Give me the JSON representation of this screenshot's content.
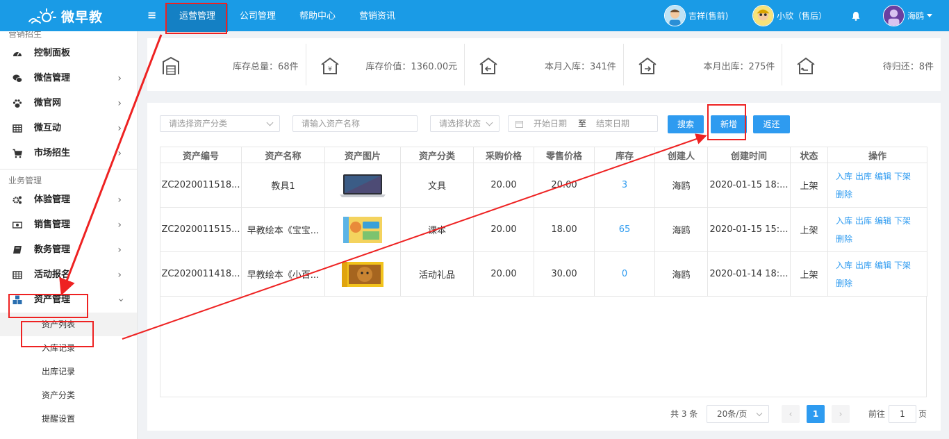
{
  "app": {
    "logo_text": "微早教"
  },
  "topnav": [
    {
      "label": "运营管理",
      "active": true
    },
    {
      "label": "公司管理"
    },
    {
      "label": "帮助中心"
    },
    {
      "label": "营销资讯"
    }
  ],
  "users": [
    {
      "name": "吉祥(售前)"
    },
    {
      "name": "小欣（售后）"
    },
    {
      "name": "海鸥"
    }
  ],
  "sidebar": {
    "section1": "营销招生",
    "group1": [
      {
        "label": "控制面板",
        "icon": "dashboard-icon",
        "chevron": false
      },
      {
        "label": "微信管理",
        "icon": "wechat-icon",
        "chevron": true
      },
      {
        "label": "微官网",
        "icon": "paw-icon",
        "chevron": true
      },
      {
        "label": "微互动",
        "icon": "grid-icon",
        "chevron": true
      },
      {
        "label": "市场招生",
        "icon": "cart-icon",
        "chevron": true
      }
    ],
    "section2": "业务管理",
    "group2": [
      {
        "label": "体验管理",
        "icon": "gears-icon",
        "chevron": true
      },
      {
        "label": "销售管理",
        "icon": "money-icon",
        "chevron": true
      },
      {
        "label": "教务管理",
        "icon": "book-icon",
        "chevron": true
      },
      {
        "label": "活动报名",
        "icon": "table-icon",
        "chevron": true
      },
      {
        "label": "资产管理",
        "icon": "cubes-icon",
        "chevron": "down"
      }
    ],
    "sub": [
      {
        "label": "资产列表",
        "active": true
      },
      {
        "label": "入库记录"
      },
      {
        "label": "出库记录"
      },
      {
        "label": "资产分类"
      },
      {
        "label": "提醒设置"
      }
    ]
  },
  "stats": [
    {
      "label": "库存总量：68件",
      "icon": "warehouse-icon"
    },
    {
      "label": "库存价值：1360.00元",
      "icon": "yen-house-icon"
    },
    {
      "label": "本月入库：341件",
      "icon": "inbound-icon"
    },
    {
      "label": "本月出库：275件",
      "icon": "outbound-icon"
    },
    {
      "label": "待归还：8件",
      "icon": "return-icon"
    }
  ],
  "filters": {
    "category_placeholder": "请选择资产分类",
    "name_placeholder": "请输入资产名称",
    "status_placeholder": "请选择状态",
    "start_placeholder": "开始日期",
    "to": "至",
    "end_placeholder": "结束日期",
    "search": "搜索",
    "add": "新增",
    "back": "返还"
  },
  "table": {
    "headers": [
      "资产编号",
      "资产名称",
      "资产图片",
      "资产分类",
      "采购价格",
      "零售价格",
      "库存",
      "创建人",
      "创建时间",
      "状态",
      "操作"
    ],
    "rows": [
      {
        "code": "ZC2020011518...",
        "name": "教具1",
        "category": "文具",
        "buy": "20.00",
        "sell": "20.00",
        "stock": "3",
        "creator": "海鸥",
        "created": "2020-01-15 18:...",
        "status": "上架",
        "image": "laptop"
      },
      {
        "code": "ZC2020011515...",
        "name": "早教绘本《宝宝...",
        "category": "课本",
        "buy": "20.00",
        "sell": "18.00",
        "stock": "65",
        "creator": "海鸥",
        "created": "2020-01-15 15:...",
        "status": "上架",
        "image": "picture-book"
      },
      {
        "code": "ZC2020011418...",
        "name": "早教绘本《小百...",
        "category": "活动礼品",
        "buy": "20.00",
        "sell": "30.00",
        "stock": "0",
        "creator": "海鸥",
        "created": "2020-01-14 18:...",
        "status": "上架",
        "image": "lion-books"
      }
    ],
    "ops": {
      "in": "入库",
      "out": "出库",
      "edit": "编辑",
      "off": "下架",
      "del": "删除"
    }
  },
  "pagination": {
    "total": "共 3 条",
    "page_size": "20条/页",
    "current": "1",
    "goto_prefix": "前往",
    "goto_value": "1",
    "goto_suffix": "页"
  },
  "colors": {
    "topbar": "#1a9be6",
    "accent": "#2e9bf0",
    "annotation": "#ee2222"
  }
}
